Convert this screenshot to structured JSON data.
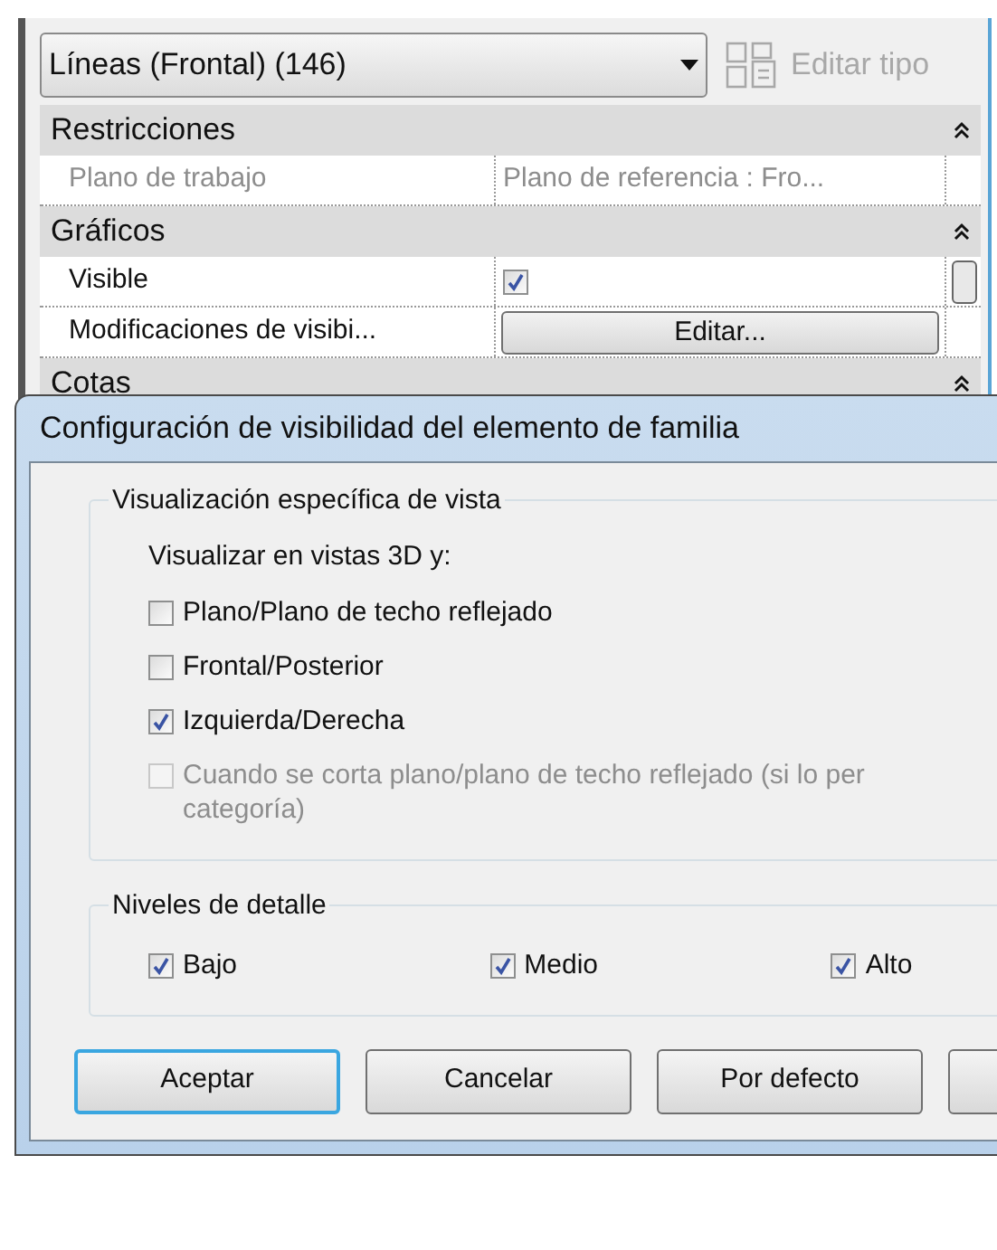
{
  "properties": {
    "type_selector": {
      "value": "Líneas (Frontal) (146)"
    },
    "edit_type_button": {
      "label": "Editar tipo",
      "disabled": true
    },
    "groups": [
      {
        "name": "Restricciones",
        "expanded": true,
        "rows": [
          {
            "kind": "text",
            "label": "Plano de trabajo",
            "value": "Plano de referencia : Fro...",
            "disabled": true
          }
        ]
      },
      {
        "name": "Gráficos",
        "expanded": true,
        "rows": [
          {
            "kind": "checkbox",
            "label": "Visible",
            "checked": true
          },
          {
            "kind": "button",
            "label": "Modificaciones de visibi...",
            "button": "Editar..."
          }
        ]
      },
      {
        "name": "Cotas",
        "expanded": true
      }
    ]
  },
  "dialog": {
    "title": "Configuración de visibilidad del elemento de familia",
    "view_group": {
      "legend": "Visualización específica de vista",
      "intro": "Visualizar en vistas 3D y:",
      "options": [
        {
          "lines": [
            "Plano/Plano de techo reflejado"
          ],
          "checked": false,
          "disabled": false
        },
        {
          "lines": [
            "Frontal/Posterior"
          ],
          "checked": false,
          "disabled": false
        },
        {
          "lines": [
            "Izquierda/Derecha"
          ],
          "checked": true,
          "disabled": false
        },
        {
          "lines": [
            "Cuando se corta plano/plano de techo reflejado (si lo per",
            "categoría)"
          ],
          "checked": false,
          "disabled": true
        }
      ]
    },
    "detail_group": {
      "legend": "Niveles de detalle",
      "options": [
        {
          "label": "Bajo",
          "checked": true
        },
        {
          "label": "Medio",
          "checked": true
        },
        {
          "label": "Alto",
          "checked": true
        }
      ]
    },
    "buttons": [
      {
        "label": "Aceptar",
        "default": true
      },
      {
        "label": "Cancelar",
        "default": false
      },
      {
        "label": "Por defecto",
        "default": false
      },
      {
        "default": false
      }
    ]
  }
}
